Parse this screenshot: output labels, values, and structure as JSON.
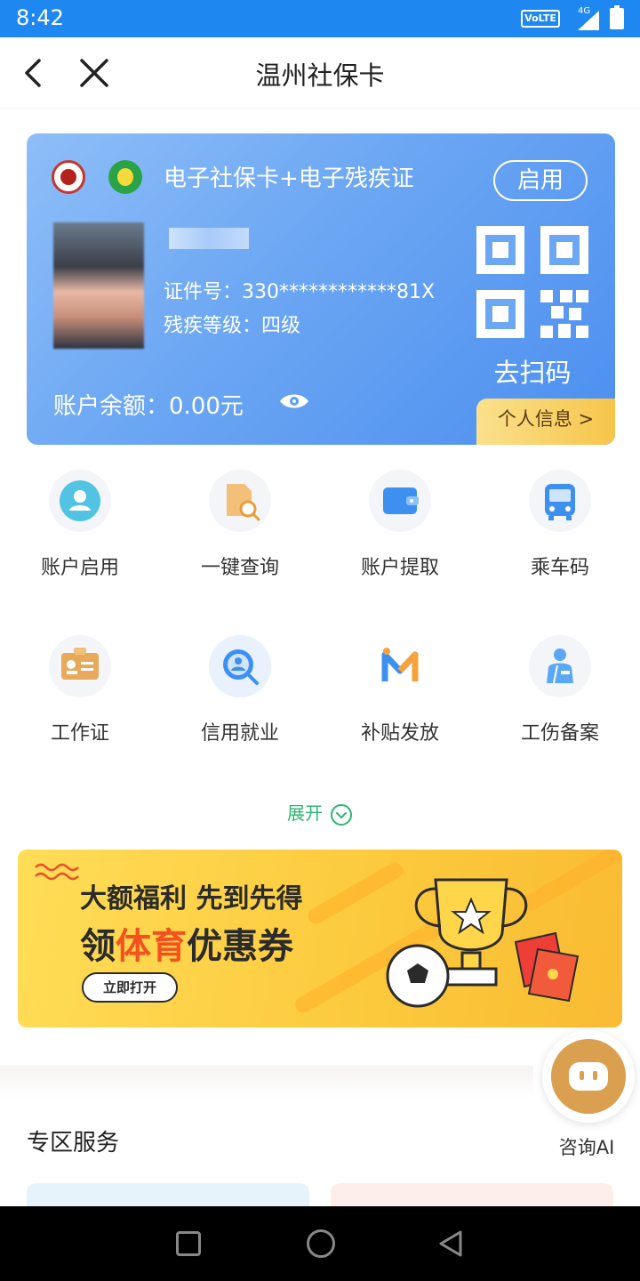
{
  "status_bar": {
    "time": "8:42",
    "volte": "VoLTE",
    "network": "4G"
  },
  "nav": {
    "title": "温州社保卡"
  },
  "card": {
    "title": "电子社保卡+电子残疾证",
    "enable_label": "启用",
    "id_text": "证件号：330************81X",
    "level_text": "残疾等级：四级",
    "balance_text": "账户余额：0.00元",
    "scan_label": "去扫码",
    "personal_label": "个人信息 >"
  },
  "services": [
    {
      "label": "账户启用",
      "icon": "user-icon"
    },
    {
      "label": "一键查询",
      "icon": "document-search-icon"
    },
    {
      "label": "账户提取",
      "icon": "wallet-icon"
    },
    {
      "label": "乘车码",
      "icon": "bus-icon"
    },
    {
      "label": "工作证",
      "icon": "id-card-icon"
    },
    {
      "label": "信用就业",
      "icon": "credit-search-icon"
    },
    {
      "label": "补贴发放",
      "icon": "subsidy-m-icon"
    },
    {
      "label": "工伤备案",
      "icon": "injury-person-icon"
    }
  ],
  "expand_label": "展开",
  "banner": {
    "line1": "大额福利 先到先得",
    "line2_a": "领",
    "line2_b": "体育",
    "line2_c": "优惠券",
    "button": "立即打开"
  },
  "ai": {
    "label": "咨询AI"
  },
  "section": {
    "title": "专区服务"
  },
  "colors": {
    "status_bar": "#1e88f0",
    "accent_green": "#2bb673",
    "banner_highlight": "#f5511e"
  }
}
